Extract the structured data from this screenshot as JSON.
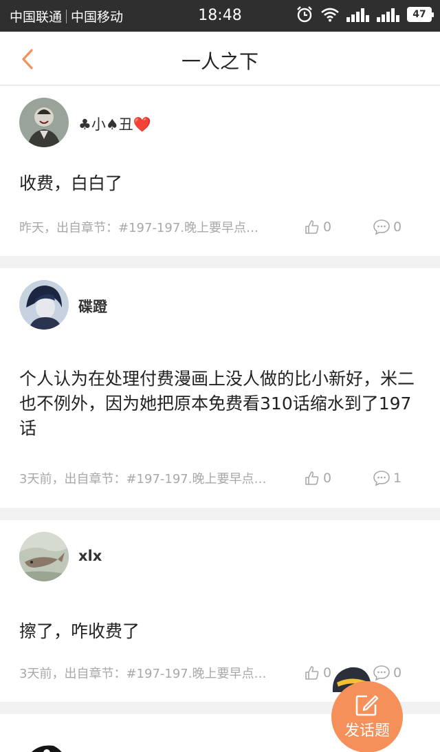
{
  "statusbar": {
    "carrier1": "中国联通",
    "carrier2": "中国移动",
    "time": "18:48",
    "battery": "47"
  },
  "header": {
    "title": "一人之下"
  },
  "posts": [
    {
      "username": "♣小♠丑❤️",
      "content": "收费，白白了",
      "meta": "昨天，出自章节：#197-197.晚上要早点…",
      "likes": "0",
      "comments": "0"
    },
    {
      "username": "碟蹬",
      "content": "个人认为在处理付费漫画上没人做的比小新好，米二也不例外，因为她把原本免费看310话缩水到了197话",
      "meta": "3天前，出自章节：#197-197.晚上要早点…",
      "likes": "0",
      "comments": "1"
    },
    {
      "username": "xlx",
      "content": "擦了，咋收费了",
      "meta": "3天前，出自章节：#197-197.晚上要早点…",
      "likes": "0",
      "comments": "0"
    }
  ],
  "fab": {
    "label": "发话题"
  },
  "colors": {
    "accent": "#f5905a",
    "meta": "#a8a8a8",
    "statusbar": "#2f2f2f"
  }
}
